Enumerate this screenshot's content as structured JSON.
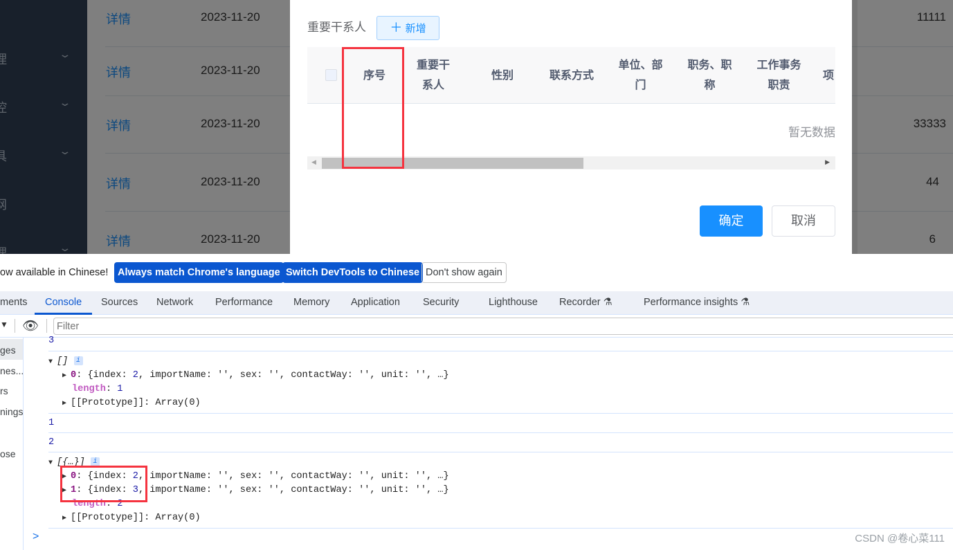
{
  "background_app": {
    "sidebar_items": [
      {
        "label": "理"
      },
      {
        "label": "控"
      },
      {
        "label": "具"
      },
      {
        "label": "网"
      },
      {
        "label": "理"
      }
    ],
    "rows": [
      {
        "link": "详情",
        "date": "2023-11-20",
        "value": "11111"
      },
      {
        "link": "详情",
        "date": "2023-11-20",
        "value": ""
      },
      {
        "link": "详情",
        "date": "2023-11-20",
        "value": "33333"
      },
      {
        "link": "详情",
        "date": "2023-11-20",
        "value": "44"
      },
      {
        "link": "详情",
        "date": "2023-11-20",
        "value": "6"
      }
    ]
  },
  "modal": {
    "section_label": "重要干系人",
    "add_button": "新增",
    "columns": [
      "序号",
      "重要干系人",
      "性别",
      "联系方式",
      "单位、部门",
      "职务、职称",
      "工作事务职责",
      "项"
    ],
    "empty_text": "暂无数据",
    "confirm": "确定",
    "cancel": "取消",
    "highlight_color": "#f5333f"
  },
  "devtools": {
    "infobar": {
      "text": "ow available in Chinese!",
      "btn_match": "Always match Chrome's language",
      "btn_switch": "Switch DevTools to Chinese",
      "btn_dismiss": "Don't show again"
    },
    "tabs": [
      "ments",
      "Console",
      "Sources",
      "Network",
      "Performance",
      "Memory",
      "Application",
      "Security",
      "Lighthouse",
      "Recorder ⚗",
      "Performance insights ⚗"
    ],
    "active_tab": "Console",
    "filter_placeholder": "Filter",
    "left_items": [
      "ges",
      "nes...",
      "rs",
      "nings",
      "ose"
    ],
    "console": {
      "l1": "3",
      "arr1": "[]",
      "obj_key0": "0",
      "obj_index2": "2",
      "obj_rest": ", importName: '', sex: '', contactWay: '', unit: '', …}",
      "length_label": "length",
      "len1": "1",
      "proto": "[[Prototype]]: Array(0)",
      "l2": "1",
      "l3": "2",
      "arr2": "[{…}]",
      "obj_key1": "1",
      "obj_index3": "3",
      "len2": "2",
      "prompt": ">"
    },
    "watermark": "CSDN @卷心菜111"
  }
}
